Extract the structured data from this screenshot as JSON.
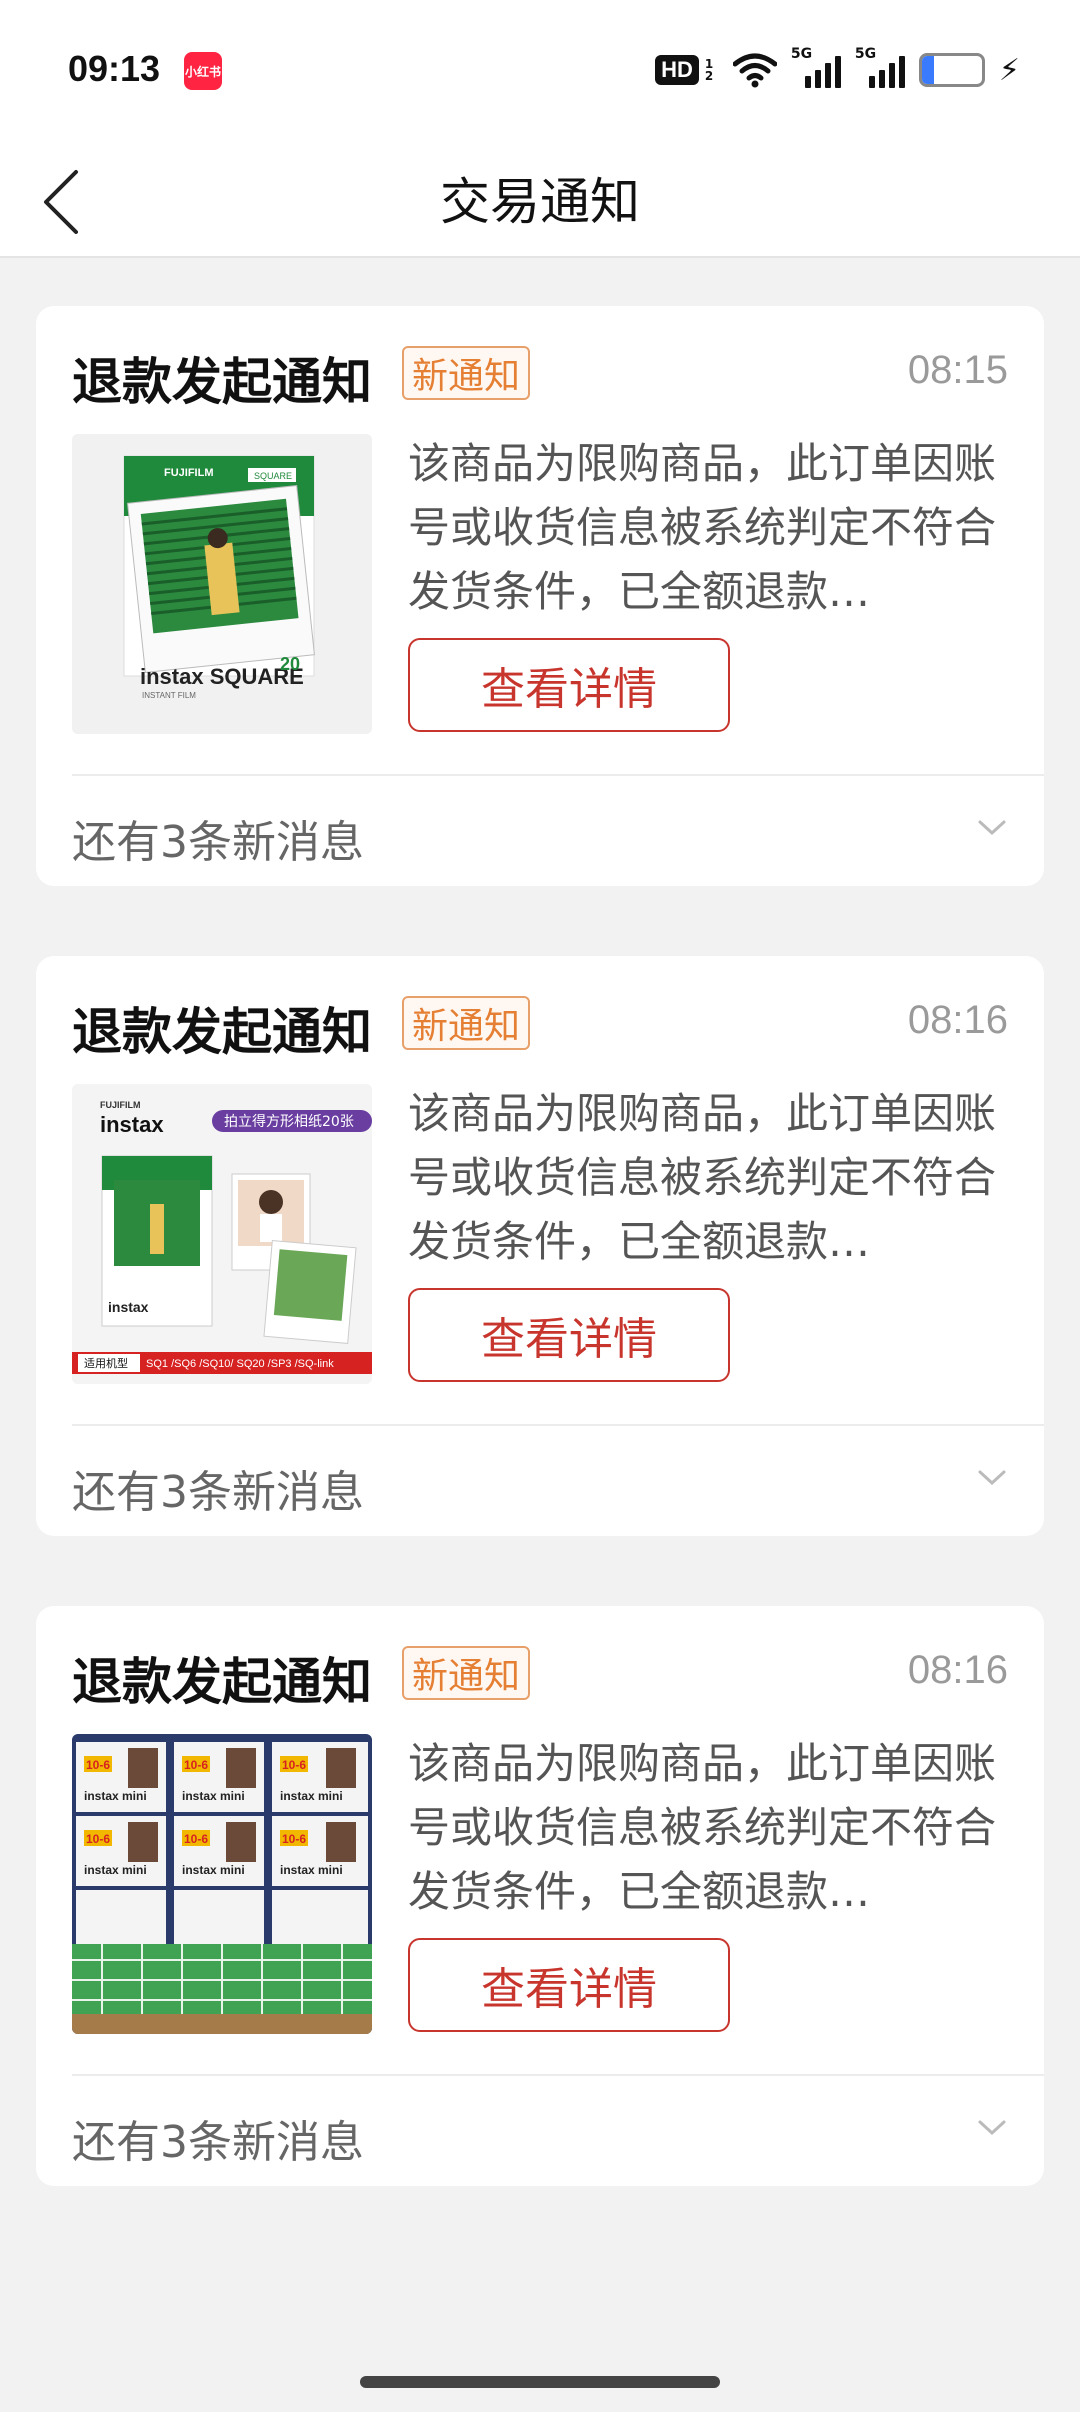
{
  "status_bar": {
    "time": "09:13",
    "app_badge": "小红书",
    "hd": "HD",
    "hd_sub": "1 2",
    "net1": "5G",
    "net2": "5G",
    "battery": "20",
    "battery_level": 0.2,
    "icons": [
      "hd-icon",
      "wifi-icon",
      "signal-icon",
      "signal-icon",
      "battery-icon",
      "charging-bolt-icon"
    ]
  },
  "header": {
    "title": "交易通知",
    "back_icon": "chevron-left-icon"
  },
  "notifications": [
    {
      "title": "退款发起通知",
      "tag": "新通知",
      "time": "08:15",
      "description": "该商品为限购商品，此订单因账号或收货信息被系统判定不符合发货条件，已全额退款…",
      "button": "查看详情",
      "more": "还有3条新消息",
      "image_text": [
        "FUJIFILM",
        "SQUARE",
        "instax SQUARE",
        "INSTANT FILM",
        "20"
      ]
    },
    {
      "title": "退款发起通知",
      "tag": "新通知",
      "time": "08:16",
      "description": "该商品为限购商品，此订单因账号或收货信息被系统判定不符合发货条件，已全额退款…",
      "button": "查看详情",
      "more": "还有3条新消息",
      "image_text": [
        "FUJIFILM",
        "instax",
        "拍立得方形相纸20张",
        "适用机型",
        "SQ1 /SQ6 /SQ10/ SQ20 /SP3 /SQ-link"
      ]
    },
    {
      "title": "退款发起通知",
      "tag": "新通知",
      "time": "08:16",
      "description": "该商品为限购商品，此订单因账号或收货信息被系统判定不符合发货条件，已全额退款…",
      "button": "查看详情",
      "more": "还有3条新消息",
      "image_text": [
        "10-6",
        "instax mini"
      ]
    }
  ],
  "colors": {
    "accent_red": "#c8352d",
    "tag_orange": "#e57f34",
    "background": "#f2f2f2"
  }
}
